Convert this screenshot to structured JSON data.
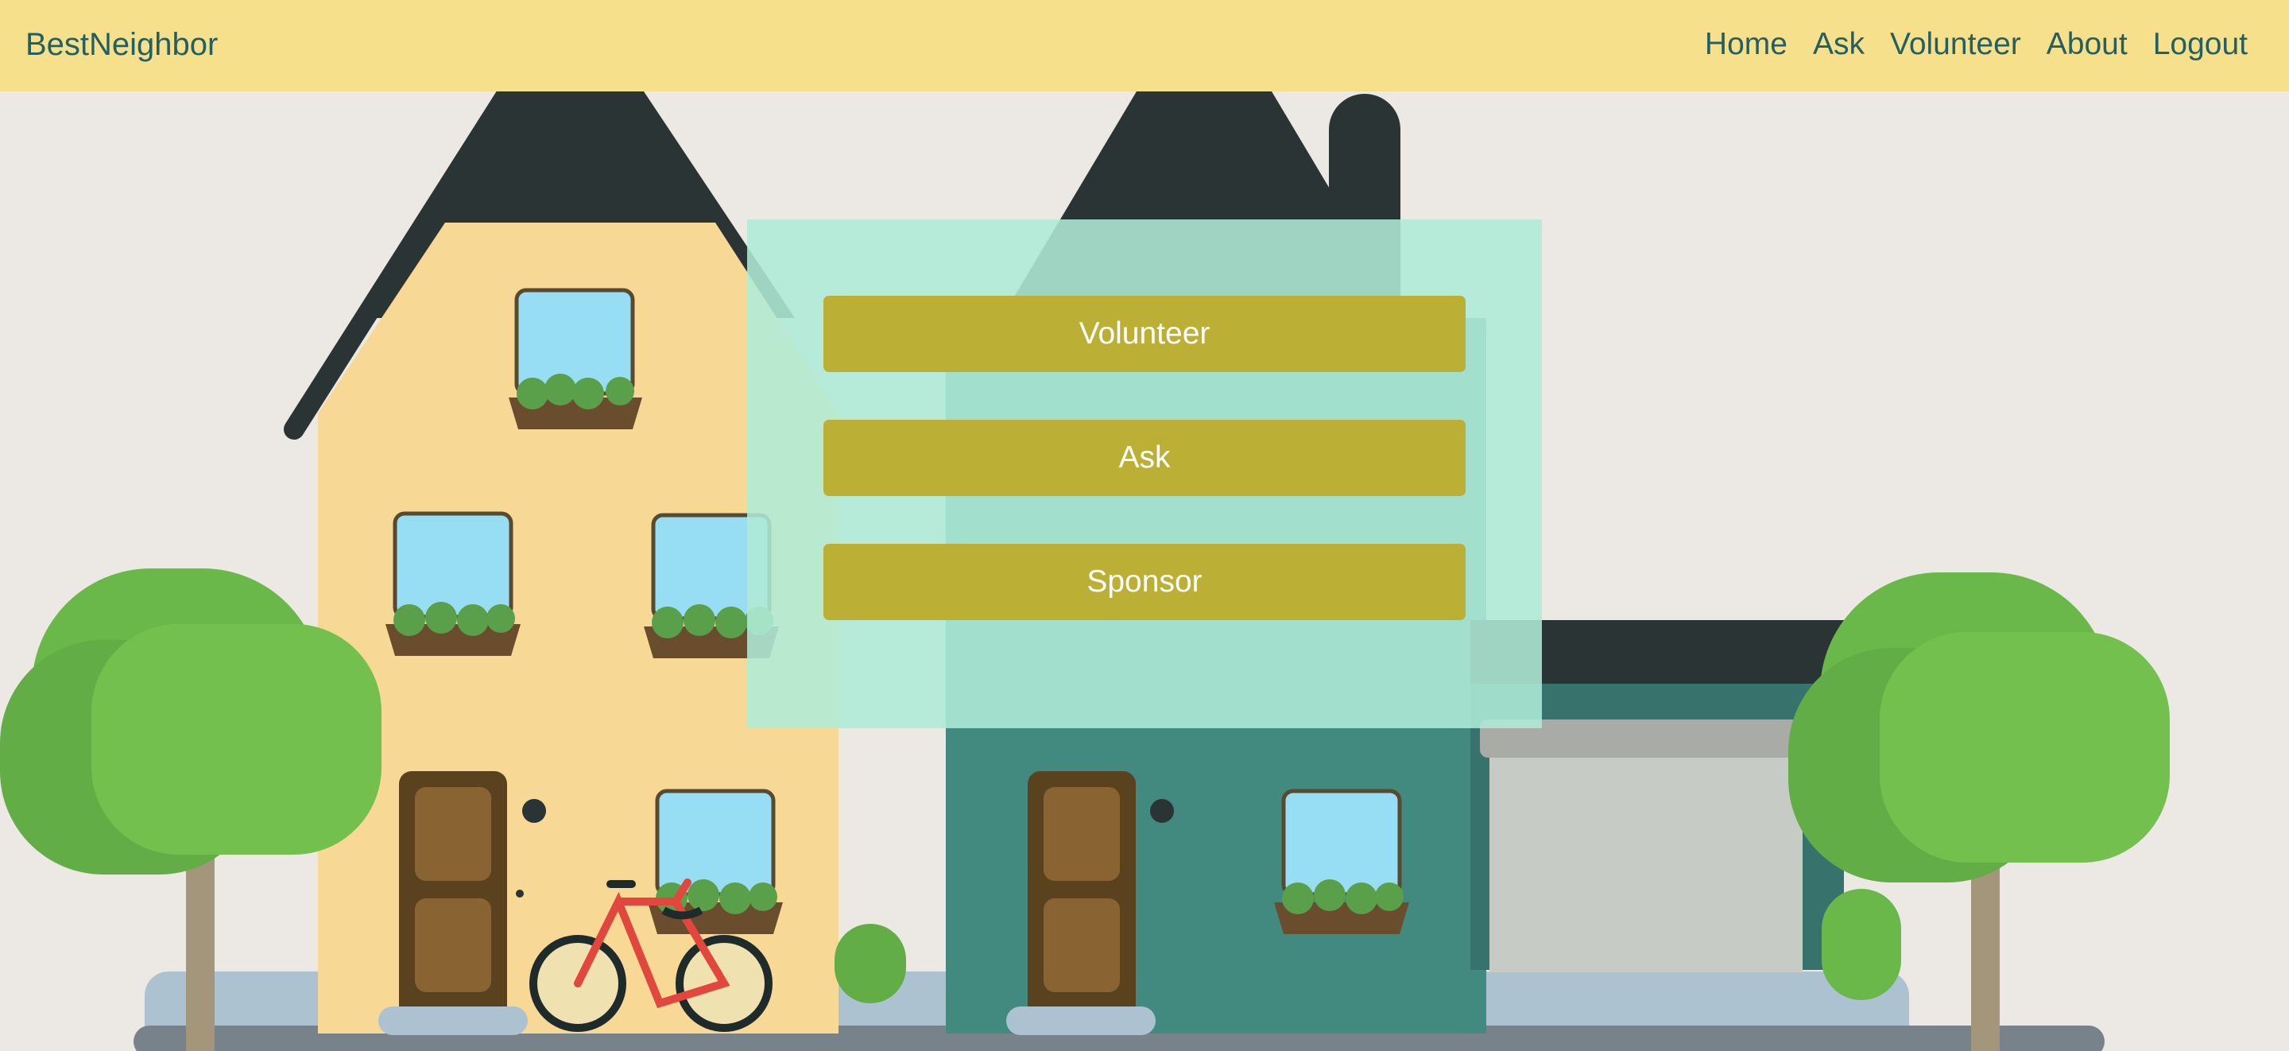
{
  "navbar": {
    "brand": "BestNeighbor",
    "links": [
      {
        "label": "Home"
      },
      {
        "label": "Ask"
      },
      {
        "label": "Volunteer"
      },
      {
        "label": "About"
      },
      {
        "label": "Logout"
      }
    ]
  },
  "panel": {
    "buttons": [
      {
        "label": "Volunteer"
      },
      {
        "label": "Ask"
      },
      {
        "label": "Sponsor"
      }
    ]
  },
  "colors": {
    "navbar_bg": "#f6e08c",
    "nav_text": "#245f62",
    "button_bg": "#bcaf36",
    "panel_bg": "#b4ebd9",
    "page_bg": "#ece9e4"
  },
  "illustration": {
    "subject": "neighborhood street with houses, trees and bicycle",
    "icons": [
      "house-yellow-icon",
      "house-teal-icon",
      "garage-icon",
      "tree-icon",
      "bicycle-icon"
    ]
  }
}
